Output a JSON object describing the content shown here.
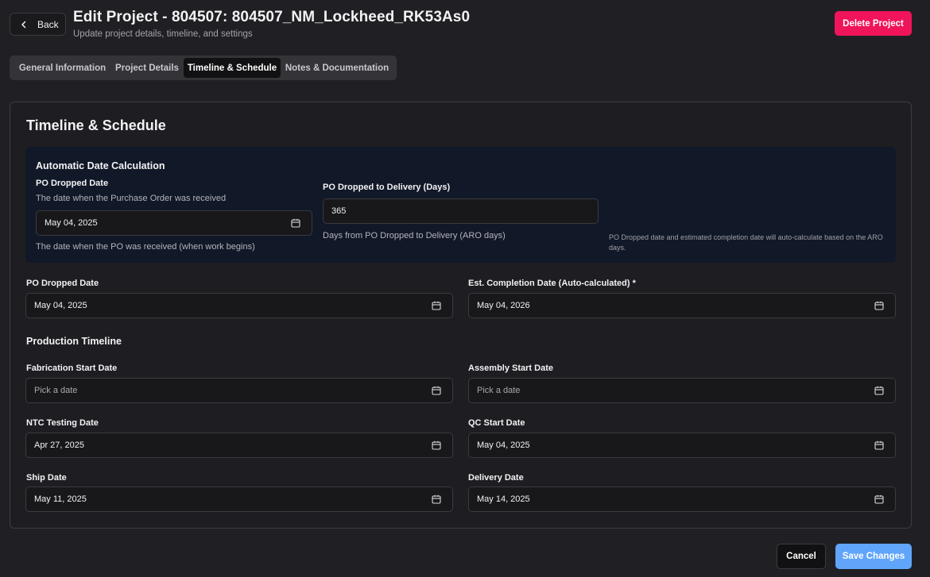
{
  "header": {
    "back_label": "Back",
    "title": "Edit Project - 804507: 804507_NM_Lockheed_RK53As0",
    "subtitle": "Update project details, timeline, and settings",
    "delete_label": "Delete Project"
  },
  "tabs": [
    {
      "label": "General Information",
      "active": false
    },
    {
      "label": "Project Details",
      "active": false
    },
    {
      "label": "Timeline & Schedule",
      "active": true
    },
    {
      "label": "Notes & Documentation",
      "active": false
    }
  ],
  "card": {
    "title": "Timeline & Schedule",
    "auto": {
      "heading": "Automatic Date Calculation",
      "po_label": "PO Dropped Date",
      "po_desc": "The date when the Purchase Order was received",
      "po_value": "May 04, 2025",
      "po_help": "The date when the PO was received (when work begins)",
      "days_label": "PO Dropped to Delivery (Days)",
      "days_value": "365",
      "days_help": "Days from PO Dropped to Delivery (ARO days)",
      "note": "PO Dropped date and estimated completion date will auto-calculate based on the ARO days."
    },
    "po_dropped": {
      "label": "PO Dropped Date",
      "value": "May 04, 2025"
    },
    "est_completion": {
      "label": "Est. Completion Date (Auto-calculated) *",
      "value": "May 04, 2026"
    },
    "production_title": "Production Timeline",
    "fabrication": {
      "label": "Fabrication Start Date",
      "placeholder": "Pick a date"
    },
    "assembly": {
      "label": "Assembly Start Date",
      "placeholder": "Pick a date"
    },
    "ntc": {
      "label": "NTC Testing Date",
      "value": "Apr 27, 2025"
    },
    "qc": {
      "label": "QC Start Date",
      "value": "May 04, 2025"
    },
    "ship": {
      "label": "Ship Date",
      "value": "May 11, 2025"
    },
    "delivery": {
      "label": "Delivery Date",
      "value": "May 14, 2025"
    }
  },
  "footer": {
    "cancel_label": "Cancel",
    "save_label": "Save Changes"
  },
  "colors": {
    "background": "#202024",
    "delete": "#f0145a",
    "save": "#60a5fa",
    "panel": "#111827"
  },
  "icons": [
    "chevron-left-icon",
    "calendar-icon"
  ]
}
